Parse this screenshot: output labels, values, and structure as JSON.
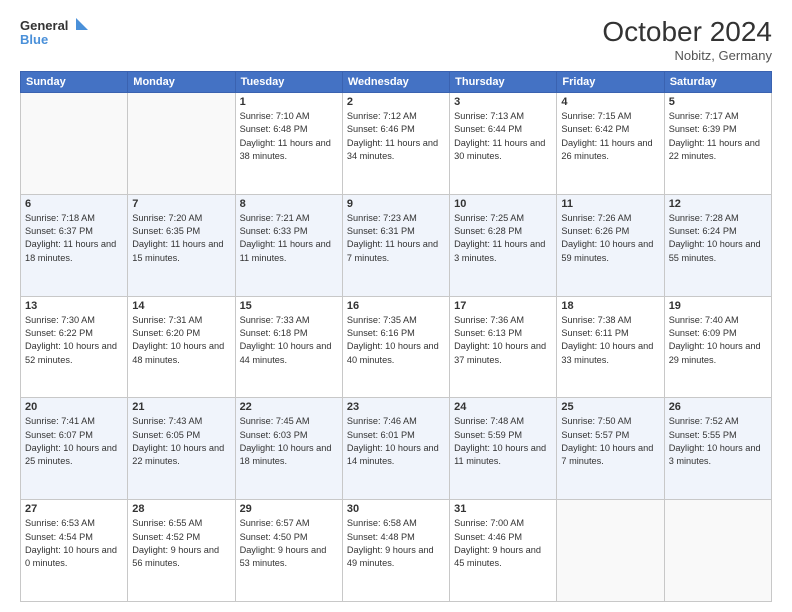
{
  "header": {
    "logo_line1": "General",
    "logo_line2": "Blue",
    "month": "October 2024",
    "location": "Nobitz, Germany"
  },
  "weekdays": [
    "Sunday",
    "Monday",
    "Tuesday",
    "Wednesday",
    "Thursday",
    "Friday",
    "Saturday"
  ],
  "weeks": [
    [
      {
        "day": "",
        "sunrise": "",
        "sunset": "",
        "daylight": ""
      },
      {
        "day": "",
        "sunrise": "",
        "sunset": "",
        "daylight": ""
      },
      {
        "day": "1",
        "sunrise": "Sunrise: 7:10 AM",
        "sunset": "Sunset: 6:48 PM",
        "daylight": "Daylight: 11 hours and 38 minutes."
      },
      {
        "day": "2",
        "sunrise": "Sunrise: 7:12 AM",
        "sunset": "Sunset: 6:46 PM",
        "daylight": "Daylight: 11 hours and 34 minutes."
      },
      {
        "day": "3",
        "sunrise": "Sunrise: 7:13 AM",
        "sunset": "Sunset: 6:44 PM",
        "daylight": "Daylight: 11 hours and 30 minutes."
      },
      {
        "day": "4",
        "sunrise": "Sunrise: 7:15 AM",
        "sunset": "Sunset: 6:42 PM",
        "daylight": "Daylight: 11 hours and 26 minutes."
      },
      {
        "day": "5",
        "sunrise": "Sunrise: 7:17 AM",
        "sunset": "Sunset: 6:39 PM",
        "daylight": "Daylight: 11 hours and 22 minutes."
      }
    ],
    [
      {
        "day": "6",
        "sunrise": "Sunrise: 7:18 AM",
        "sunset": "Sunset: 6:37 PM",
        "daylight": "Daylight: 11 hours and 18 minutes."
      },
      {
        "day": "7",
        "sunrise": "Sunrise: 7:20 AM",
        "sunset": "Sunset: 6:35 PM",
        "daylight": "Daylight: 11 hours and 15 minutes."
      },
      {
        "day": "8",
        "sunrise": "Sunrise: 7:21 AM",
        "sunset": "Sunset: 6:33 PM",
        "daylight": "Daylight: 11 hours and 11 minutes."
      },
      {
        "day": "9",
        "sunrise": "Sunrise: 7:23 AM",
        "sunset": "Sunset: 6:31 PM",
        "daylight": "Daylight: 11 hours and 7 minutes."
      },
      {
        "day": "10",
        "sunrise": "Sunrise: 7:25 AM",
        "sunset": "Sunset: 6:28 PM",
        "daylight": "Daylight: 11 hours and 3 minutes."
      },
      {
        "day": "11",
        "sunrise": "Sunrise: 7:26 AM",
        "sunset": "Sunset: 6:26 PM",
        "daylight": "Daylight: 10 hours and 59 minutes."
      },
      {
        "day": "12",
        "sunrise": "Sunrise: 7:28 AM",
        "sunset": "Sunset: 6:24 PM",
        "daylight": "Daylight: 10 hours and 55 minutes."
      }
    ],
    [
      {
        "day": "13",
        "sunrise": "Sunrise: 7:30 AM",
        "sunset": "Sunset: 6:22 PM",
        "daylight": "Daylight: 10 hours and 52 minutes."
      },
      {
        "day": "14",
        "sunrise": "Sunrise: 7:31 AM",
        "sunset": "Sunset: 6:20 PM",
        "daylight": "Daylight: 10 hours and 48 minutes."
      },
      {
        "day": "15",
        "sunrise": "Sunrise: 7:33 AM",
        "sunset": "Sunset: 6:18 PM",
        "daylight": "Daylight: 10 hours and 44 minutes."
      },
      {
        "day": "16",
        "sunrise": "Sunrise: 7:35 AM",
        "sunset": "Sunset: 6:16 PM",
        "daylight": "Daylight: 10 hours and 40 minutes."
      },
      {
        "day": "17",
        "sunrise": "Sunrise: 7:36 AM",
        "sunset": "Sunset: 6:13 PM",
        "daylight": "Daylight: 10 hours and 37 minutes."
      },
      {
        "day": "18",
        "sunrise": "Sunrise: 7:38 AM",
        "sunset": "Sunset: 6:11 PM",
        "daylight": "Daylight: 10 hours and 33 minutes."
      },
      {
        "day": "19",
        "sunrise": "Sunrise: 7:40 AM",
        "sunset": "Sunset: 6:09 PM",
        "daylight": "Daylight: 10 hours and 29 minutes."
      }
    ],
    [
      {
        "day": "20",
        "sunrise": "Sunrise: 7:41 AM",
        "sunset": "Sunset: 6:07 PM",
        "daylight": "Daylight: 10 hours and 25 minutes."
      },
      {
        "day": "21",
        "sunrise": "Sunrise: 7:43 AM",
        "sunset": "Sunset: 6:05 PM",
        "daylight": "Daylight: 10 hours and 22 minutes."
      },
      {
        "day": "22",
        "sunrise": "Sunrise: 7:45 AM",
        "sunset": "Sunset: 6:03 PM",
        "daylight": "Daylight: 10 hours and 18 minutes."
      },
      {
        "day": "23",
        "sunrise": "Sunrise: 7:46 AM",
        "sunset": "Sunset: 6:01 PM",
        "daylight": "Daylight: 10 hours and 14 minutes."
      },
      {
        "day": "24",
        "sunrise": "Sunrise: 7:48 AM",
        "sunset": "Sunset: 5:59 PM",
        "daylight": "Daylight: 10 hours and 11 minutes."
      },
      {
        "day": "25",
        "sunrise": "Sunrise: 7:50 AM",
        "sunset": "Sunset: 5:57 PM",
        "daylight": "Daylight: 10 hours and 7 minutes."
      },
      {
        "day": "26",
        "sunrise": "Sunrise: 7:52 AM",
        "sunset": "Sunset: 5:55 PM",
        "daylight": "Daylight: 10 hours and 3 minutes."
      }
    ],
    [
      {
        "day": "27",
        "sunrise": "Sunrise: 6:53 AM",
        "sunset": "Sunset: 4:54 PM",
        "daylight": "Daylight: 10 hours and 0 minutes."
      },
      {
        "day": "28",
        "sunrise": "Sunrise: 6:55 AM",
        "sunset": "Sunset: 4:52 PM",
        "daylight": "Daylight: 9 hours and 56 minutes."
      },
      {
        "day": "29",
        "sunrise": "Sunrise: 6:57 AM",
        "sunset": "Sunset: 4:50 PM",
        "daylight": "Daylight: 9 hours and 53 minutes."
      },
      {
        "day": "30",
        "sunrise": "Sunrise: 6:58 AM",
        "sunset": "Sunset: 4:48 PM",
        "daylight": "Daylight: 9 hours and 49 minutes."
      },
      {
        "day": "31",
        "sunrise": "Sunrise: 7:00 AM",
        "sunset": "Sunset: 4:46 PM",
        "daylight": "Daylight: 9 hours and 45 minutes."
      },
      {
        "day": "",
        "sunrise": "",
        "sunset": "",
        "daylight": ""
      },
      {
        "day": "",
        "sunrise": "",
        "sunset": "",
        "daylight": ""
      }
    ]
  ]
}
